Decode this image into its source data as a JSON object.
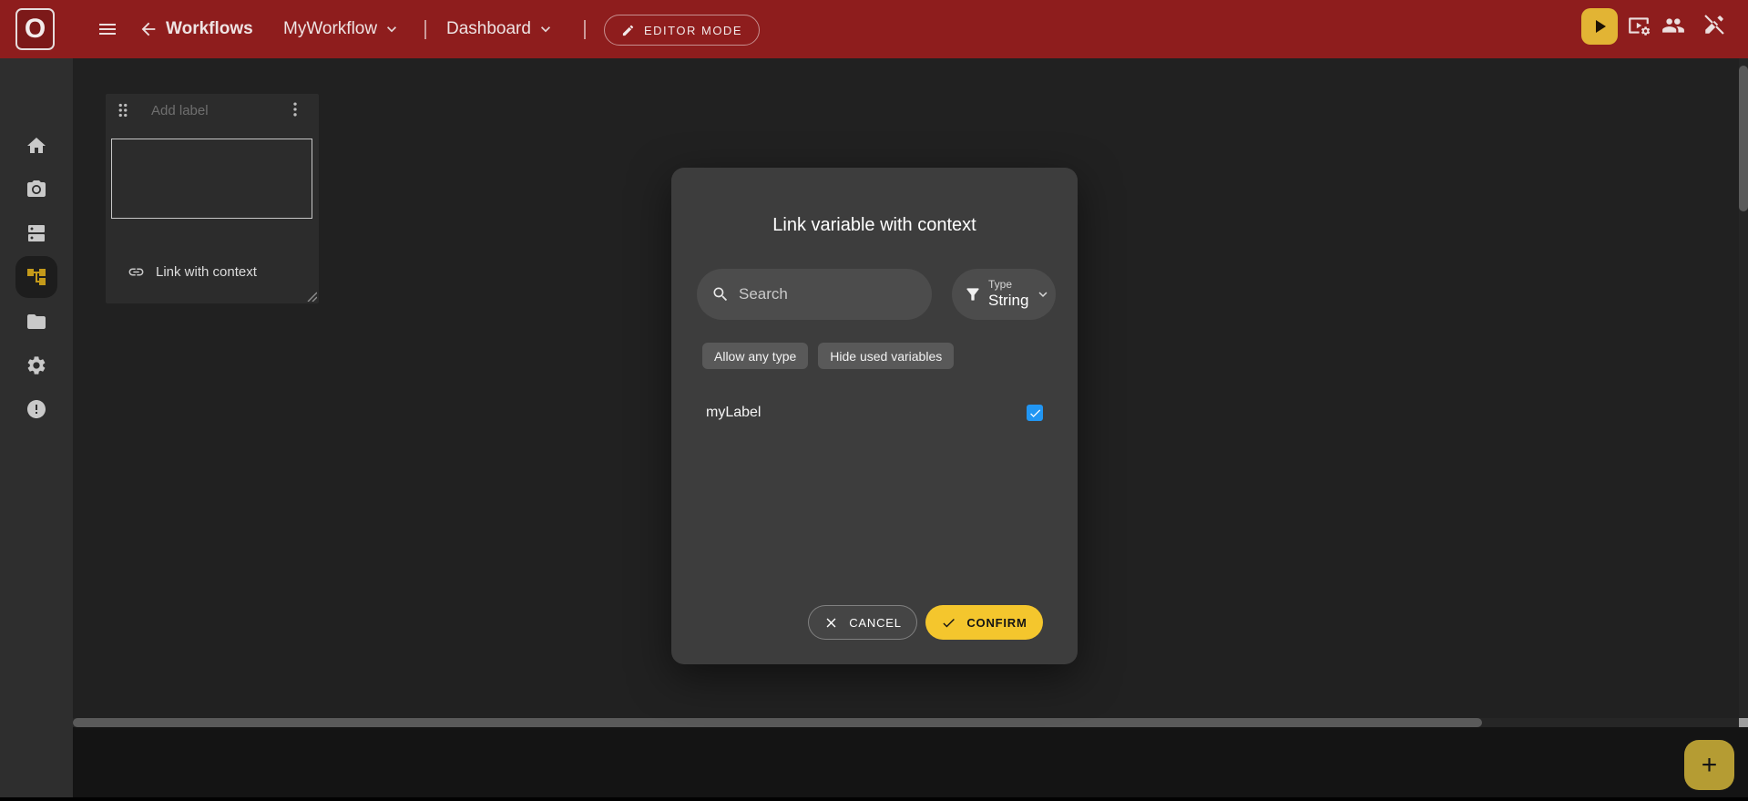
{
  "topbar": {
    "logo_letter": "O",
    "nav": {
      "section_label": "Workflows",
      "workflow_name": "MyWorkflow",
      "view_name": "Dashboard",
      "separator": "|"
    },
    "editor_mode_label": "EDITOR MODE"
  },
  "sidebar": {
    "items": [
      {
        "id": "home",
        "icon": "home-icon",
        "active": false
      },
      {
        "id": "capture",
        "icon": "camera-icon",
        "active": false
      },
      {
        "id": "panels",
        "icon": "dns-icon",
        "active": false
      },
      {
        "id": "workflows",
        "icon": "workflow-tree-icon",
        "active": true
      },
      {
        "id": "files",
        "icon": "folder-icon",
        "active": false
      },
      {
        "id": "settings",
        "icon": "gear-icon",
        "active": false
      },
      {
        "id": "alerts",
        "icon": "error-icon",
        "active": false
      }
    ]
  },
  "canvas": {
    "label_widget": {
      "placeholder": "Add label",
      "link_action_label": "Link with context"
    }
  },
  "dialog": {
    "title": "Link variable with context",
    "search_placeholder": "Search",
    "type_filter": {
      "label": "Type",
      "value": "String"
    },
    "chips": [
      {
        "label": "Allow any type"
      },
      {
        "label": "Hide used variables"
      }
    ],
    "variables": [
      {
        "name": "myLabel",
        "checked": true
      }
    ],
    "cancel_label": "CANCEL",
    "confirm_label": "CONFIRM"
  },
  "fab_glyph": "+",
  "colors": {
    "topbar_red": "#8e1d1d",
    "run_button_yellow": "#e2b434",
    "confirm_yellow": "#f4c62d",
    "fab_yellow": "#b59c33",
    "checkbox_blue": "#2196f3",
    "active_sidebar_icon": "#c49a1a"
  }
}
